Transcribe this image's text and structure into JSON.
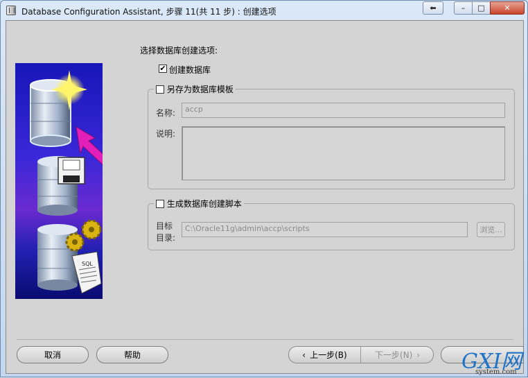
{
  "window": {
    "title": "Database Configuration Assistant, 步骤 11(共 11 步) : 创建选项"
  },
  "main": {
    "prompt": "选择数据库创建选项:",
    "create_database": {
      "label": "创建数据库",
      "checked": true
    },
    "save_template": {
      "label": "另存为数据库模板",
      "checked": false,
      "name_label": "名称:",
      "name_value": "accp",
      "desc_label": "说明:"
    },
    "generate_scripts": {
      "label": "生成数据库创建脚本",
      "checked": false,
      "dest_label_line1": "目标",
      "dest_label_line2": "目录:",
      "dest_value": "C:\\Oracle11g\\admin\\accp\\scripts",
      "browse_label": "浏览..."
    }
  },
  "illustration": {
    "icons": [
      "database-star-icon",
      "database-floppy-icon",
      "database-sql-gears-icon"
    ],
    "sql_text": "SQL"
  },
  "footer": {
    "cancel_label": "取消",
    "help_label": "帮助",
    "back_label": "上一步(B)",
    "next_label": "下一步(N)"
  },
  "watermark": {
    "big": "GXI网",
    "small": "system.com"
  },
  "colors": {
    "title_close": "#c8442c",
    "illustration_bg": "#2a1fc8",
    "disabled_text": "#8a8a8a"
  }
}
